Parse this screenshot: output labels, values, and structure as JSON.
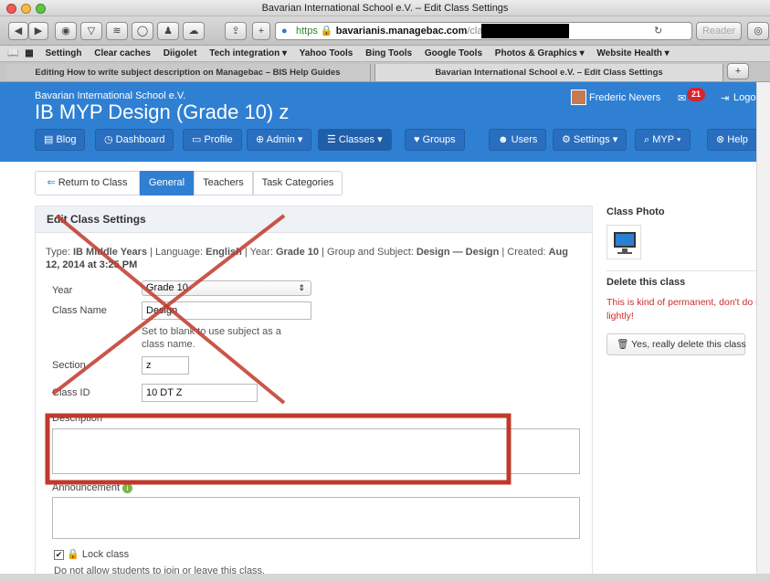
{
  "window": {
    "title": "Bavarian International School e.V. – Edit Class Settings",
    "url_scheme": "https",
    "url_host": "bavarianis.managebac.com",
    "url_path": "/classes/",
    "reader_label": "Reader"
  },
  "bookmarks": [
    "Settingh",
    "Clear caches",
    "Diigolet",
    "Tech integration ▾",
    "Yahoo Tools",
    "Bing Tools",
    "Google Tools",
    "Photos & Graphics ▾",
    "Website Health ▾"
  ],
  "browser_tabs": [
    "Editing How to write subject description on Managebac – BIS Help Guides",
    "Bavarian International School e.V. – Edit Class Settings"
  ],
  "header": {
    "school_name": "Bavarian International School e.V.",
    "class_title": "IB MYP Design (Grade 10) z",
    "user_name": "Frederic Nevers",
    "notification_count": "21",
    "logout_label": "Logout"
  },
  "nav": [
    "Blog",
    "Dashboard",
    "Profile",
    "Admin",
    "Classes",
    "Groups",
    "Users",
    "Settings",
    "MYP",
    "Help"
  ],
  "tabs": [
    "Return to Class",
    "General",
    "Teachers",
    "Task Categories"
  ],
  "form": {
    "card_title": "Edit Class Settings",
    "meta_line1_parts": [
      "Type: ",
      "IB Middle Years",
      " | Language: ",
      "English",
      " | Year: ",
      "Grade 10",
      " | Group and Subject: ",
      "Design — Design",
      " | Created: ",
      "Aug"
    ],
    "meta_line2": "12, 2014 at 3:25 PM",
    "year_label": "Year",
    "year_value": "Grade 10",
    "class_name_label": "Class Name",
    "class_name_value": "Design",
    "class_name_help": "Set to blank to use subject as a class name.",
    "section_label": "Section",
    "section_value": "z",
    "class_id_label": "Class ID",
    "class_id_value": "10 DT Z",
    "description_label": "Description",
    "announcement_label": "Announcement",
    "lock_label": "Lock class",
    "lock_help": "Do not allow students to join or leave this class."
  },
  "sidebar": {
    "photo_title": "Class Photo",
    "delete_title": "Delete this class",
    "delete_warning": "This is kind of permanent, don't do it lightly!",
    "delete_button": "Yes, really delete this class"
  },
  "colors": {
    "header_blue": "#2f80d2",
    "annotation_red": "#c0392b",
    "warning_red": "#cc2d2d",
    "notification_red": "#d9232c"
  }
}
